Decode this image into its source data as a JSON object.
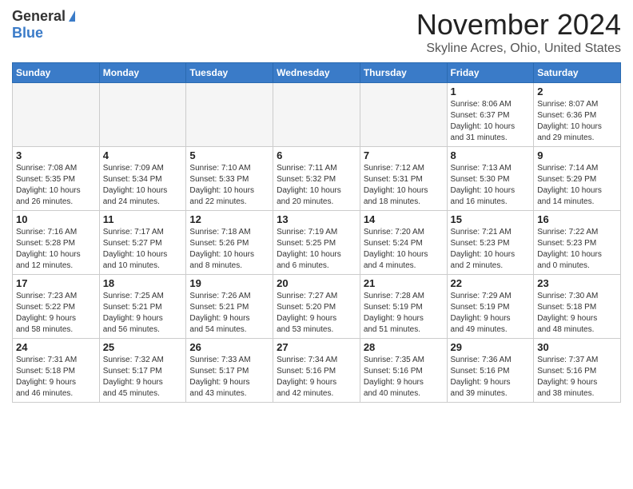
{
  "header": {
    "logo_general": "General",
    "logo_blue": "Blue",
    "month_year": "November 2024",
    "location": "Skyline Acres, Ohio, United States"
  },
  "days_of_week": [
    "Sunday",
    "Monday",
    "Tuesday",
    "Wednesday",
    "Thursday",
    "Friday",
    "Saturday"
  ],
  "weeks": [
    [
      {
        "day": "",
        "info": ""
      },
      {
        "day": "",
        "info": ""
      },
      {
        "day": "",
        "info": ""
      },
      {
        "day": "",
        "info": ""
      },
      {
        "day": "",
        "info": ""
      },
      {
        "day": "1",
        "info": "Sunrise: 8:06 AM\nSunset: 6:37 PM\nDaylight: 10 hours\nand 31 minutes."
      },
      {
        "day": "2",
        "info": "Sunrise: 8:07 AM\nSunset: 6:36 PM\nDaylight: 10 hours\nand 29 minutes."
      }
    ],
    [
      {
        "day": "3",
        "info": "Sunrise: 7:08 AM\nSunset: 5:35 PM\nDaylight: 10 hours\nand 26 minutes."
      },
      {
        "day": "4",
        "info": "Sunrise: 7:09 AM\nSunset: 5:34 PM\nDaylight: 10 hours\nand 24 minutes."
      },
      {
        "day": "5",
        "info": "Sunrise: 7:10 AM\nSunset: 5:33 PM\nDaylight: 10 hours\nand 22 minutes."
      },
      {
        "day": "6",
        "info": "Sunrise: 7:11 AM\nSunset: 5:32 PM\nDaylight: 10 hours\nand 20 minutes."
      },
      {
        "day": "7",
        "info": "Sunrise: 7:12 AM\nSunset: 5:31 PM\nDaylight: 10 hours\nand 18 minutes."
      },
      {
        "day": "8",
        "info": "Sunrise: 7:13 AM\nSunset: 5:30 PM\nDaylight: 10 hours\nand 16 minutes."
      },
      {
        "day": "9",
        "info": "Sunrise: 7:14 AM\nSunset: 5:29 PM\nDaylight: 10 hours\nand 14 minutes."
      }
    ],
    [
      {
        "day": "10",
        "info": "Sunrise: 7:16 AM\nSunset: 5:28 PM\nDaylight: 10 hours\nand 12 minutes."
      },
      {
        "day": "11",
        "info": "Sunrise: 7:17 AM\nSunset: 5:27 PM\nDaylight: 10 hours\nand 10 minutes."
      },
      {
        "day": "12",
        "info": "Sunrise: 7:18 AM\nSunset: 5:26 PM\nDaylight: 10 hours\nand 8 minutes."
      },
      {
        "day": "13",
        "info": "Sunrise: 7:19 AM\nSunset: 5:25 PM\nDaylight: 10 hours\nand 6 minutes."
      },
      {
        "day": "14",
        "info": "Sunrise: 7:20 AM\nSunset: 5:24 PM\nDaylight: 10 hours\nand 4 minutes."
      },
      {
        "day": "15",
        "info": "Sunrise: 7:21 AM\nSunset: 5:23 PM\nDaylight: 10 hours\nand 2 minutes."
      },
      {
        "day": "16",
        "info": "Sunrise: 7:22 AM\nSunset: 5:23 PM\nDaylight: 10 hours\nand 0 minutes."
      }
    ],
    [
      {
        "day": "17",
        "info": "Sunrise: 7:23 AM\nSunset: 5:22 PM\nDaylight: 9 hours\nand 58 minutes."
      },
      {
        "day": "18",
        "info": "Sunrise: 7:25 AM\nSunset: 5:21 PM\nDaylight: 9 hours\nand 56 minutes."
      },
      {
        "day": "19",
        "info": "Sunrise: 7:26 AM\nSunset: 5:21 PM\nDaylight: 9 hours\nand 54 minutes."
      },
      {
        "day": "20",
        "info": "Sunrise: 7:27 AM\nSunset: 5:20 PM\nDaylight: 9 hours\nand 53 minutes."
      },
      {
        "day": "21",
        "info": "Sunrise: 7:28 AM\nSunset: 5:19 PM\nDaylight: 9 hours\nand 51 minutes."
      },
      {
        "day": "22",
        "info": "Sunrise: 7:29 AM\nSunset: 5:19 PM\nDaylight: 9 hours\nand 49 minutes."
      },
      {
        "day": "23",
        "info": "Sunrise: 7:30 AM\nSunset: 5:18 PM\nDaylight: 9 hours\nand 48 minutes."
      }
    ],
    [
      {
        "day": "24",
        "info": "Sunrise: 7:31 AM\nSunset: 5:18 PM\nDaylight: 9 hours\nand 46 minutes."
      },
      {
        "day": "25",
        "info": "Sunrise: 7:32 AM\nSunset: 5:17 PM\nDaylight: 9 hours\nand 45 minutes."
      },
      {
        "day": "26",
        "info": "Sunrise: 7:33 AM\nSunset: 5:17 PM\nDaylight: 9 hours\nand 43 minutes."
      },
      {
        "day": "27",
        "info": "Sunrise: 7:34 AM\nSunset: 5:16 PM\nDaylight: 9 hours\nand 42 minutes."
      },
      {
        "day": "28",
        "info": "Sunrise: 7:35 AM\nSunset: 5:16 PM\nDaylight: 9 hours\nand 40 minutes."
      },
      {
        "day": "29",
        "info": "Sunrise: 7:36 AM\nSunset: 5:16 PM\nDaylight: 9 hours\nand 39 minutes."
      },
      {
        "day": "30",
        "info": "Sunrise: 7:37 AM\nSunset: 5:16 PM\nDaylight: 9 hours\nand 38 minutes."
      }
    ]
  ]
}
